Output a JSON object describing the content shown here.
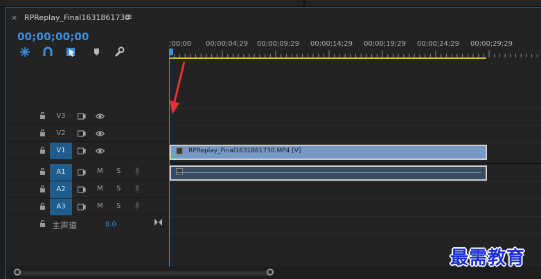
{
  "tab": {
    "close_glyph": "×",
    "title": "RPReplay_Final1631861730",
    "menu_glyph": "≡"
  },
  "timecode": "00;00;00;00",
  "toolbar": [
    "snap-icon",
    "link-icon",
    "marker-in-icon",
    "add-marker-icon",
    "wrench-icon"
  ],
  "ruler": {
    "labels": [
      ";00;00",
      "00;00;04;29",
      "00;00;09;29",
      "00;00;14;29",
      "00;00;19;29",
      "00;00;24;29",
      "00;00;29;29"
    ]
  },
  "tracks": {
    "video": [
      {
        "name": "V3",
        "active": false
      },
      {
        "name": "V2",
        "active": false
      },
      {
        "name": "V1",
        "active": true
      }
    ],
    "audio": [
      {
        "name": "A1",
        "active": true,
        "mute": "M",
        "solo": "S"
      },
      {
        "name": "A2",
        "active": true,
        "mute": "M",
        "solo": "S"
      },
      {
        "name": "A3",
        "active": true,
        "mute": "M",
        "solo": "S"
      }
    ],
    "master": {
      "label": "主声道",
      "value": "0.0"
    }
  },
  "clips": {
    "video_label": "RPReplay_Final1631861730.MP4 [V]"
  },
  "watermark": "最需教育",
  "colors": {
    "accent": "#3b8fe0",
    "video_clip": "#7699c6",
    "audio_clip": "#3a4b60",
    "work_area": "#d8c528",
    "track_active": "#1f5d8c",
    "arrow": "#e8332e"
  }
}
